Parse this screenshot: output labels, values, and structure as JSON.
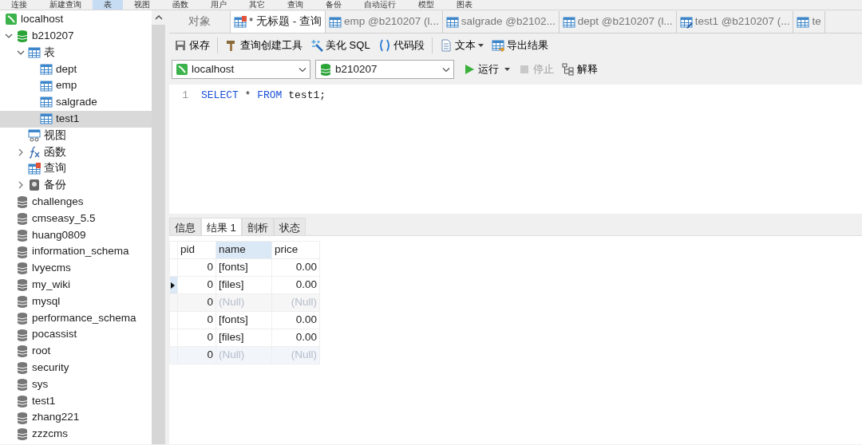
{
  "menu": [
    {
      "label": "连接",
      "selected": false
    },
    {
      "label": "新建查询",
      "selected": false
    },
    {
      "label": "表",
      "selected": true
    },
    {
      "label": "视图",
      "selected": false
    },
    {
      "label": "函数",
      "selected": false
    },
    {
      "label": "用户",
      "selected": false
    },
    {
      "label": "其它",
      "selected": false
    },
    {
      "label": "查询",
      "selected": false
    },
    {
      "label": "备份",
      "selected": false
    },
    {
      "label": "自动运行",
      "selected": false
    },
    {
      "label": "模型",
      "selected": false
    },
    {
      "label": "图表",
      "selected": false
    }
  ],
  "sidebar": {
    "items": [
      {
        "label": "localhost",
        "kind": "connection",
        "selected": false
      },
      {
        "label": "b210207",
        "kind": "database",
        "open": true,
        "expanded": true,
        "selected": false,
        "children": [
          {
            "label": "表",
            "kind": "tables",
            "expanded": true,
            "selected": false,
            "children": [
              {
                "label": "dept",
                "kind": "table",
                "selected": false
              },
              {
                "label": "emp",
                "kind": "table",
                "selected": false
              },
              {
                "label": "salgrade",
                "kind": "table",
                "selected": false
              },
              {
                "label": "test1",
                "kind": "table",
                "selected": true
              }
            ]
          },
          {
            "label": "视图",
            "kind": "views",
            "selected": false
          },
          {
            "label": "函数",
            "kind": "functions",
            "expanded": false,
            "selected": false
          },
          {
            "label": "查询",
            "kind": "queries",
            "selected": false
          },
          {
            "label": "备份",
            "kind": "backups",
            "expanded": false,
            "selected": false
          }
        ]
      },
      {
        "label": "challenges",
        "kind": "database",
        "open": false,
        "selected": false
      },
      {
        "label": "cmseasy_5.5",
        "kind": "database",
        "open": false,
        "selected": false
      },
      {
        "label": "huang0809",
        "kind": "database",
        "open": false,
        "selected": false
      },
      {
        "label": "information_schema",
        "kind": "database",
        "open": false,
        "selected": false
      },
      {
        "label": "lvyecms",
        "kind": "database",
        "open": false,
        "selected": false
      },
      {
        "label": "my_wiki",
        "kind": "database",
        "open": false,
        "selected": false
      },
      {
        "label": "mysql",
        "kind": "database",
        "open": false,
        "selected": false
      },
      {
        "label": "performance_schema",
        "kind": "database",
        "open": false,
        "selected": false
      },
      {
        "label": "pocassist",
        "kind": "database",
        "open": false,
        "selected": false
      },
      {
        "label": "root",
        "kind": "database",
        "open": false,
        "selected": false
      },
      {
        "label": "security",
        "kind": "database",
        "open": false,
        "selected": false
      },
      {
        "label": "sys",
        "kind": "database",
        "open": false,
        "selected": false
      },
      {
        "label": "test1",
        "kind": "database",
        "open": false,
        "selected": false
      },
      {
        "label": "zhang221",
        "kind": "database",
        "open": false,
        "selected": false
      },
      {
        "label": "zzzcms",
        "kind": "database",
        "open": false,
        "selected": false
      }
    ]
  },
  "tabs": [
    {
      "label": "对象",
      "kind": "plain",
      "selected": false
    },
    {
      "label": "* 无标题 - 查询",
      "kind": "query",
      "selected": true
    },
    {
      "label": "emp @b210207 (l...",
      "kind": "table",
      "selected": false
    },
    {
      "label": "salgrade @b2102...",
      "kind": "table",
      "selected": false
    },
    {
      "label": "dept @b210207 (l...",
      "kind": "table",
      "selected": false
    },
    {
      "label": "test1 @b210207 (...",
      "kind": "table-edit",
      "selected": false
    },
    {
      "label": "te",
      "kind": "table",
      "selected": false
    }
  ],
  "toolbar": [
    {
      "label": "保存",
      "kind": "save"
    },
    {
      "label": "查询创建工具",
      "kind": "builder"
    },
    {
      "label": "美化 SQL",
      "kind": "beautify"
    },
    {
      "label": "代码段",
      "kind": "snippet"
    },
    {
      "label": "文本",
      "kind": "text",
      "dropdown": true
    },
    {
      "label": "导出结果",
      "kind": "export"
    }
  ],
  "connection_select": {
    "value": "localhost"
  },
  "database_select": {
    "value": "b210207"
  },
  "actions": [
    {
      "label": "运行",
      "kind": "run",
      "dropdown": true,
      "disabled": false
    },
    {
      "label": "停止",
      "kind": "stop",
      "disabled": true
    },
    {
      "label": "解释",
      "kind": "explain",
      "disabled": false
    }
  ],
  "editor": {
    "lines": [
      {
        "number": "1",
        "tokens": [
          {
            "text": "SELECT",
            "kind": "keyword"
          },
          {
            "text": " * ",
            "kind": "plain"
          },
          {
            "text": "FROM",
            "kind": "keyword"
          },
          {
            "text": " test1;",
            "kind": "plain"
          }
        ]
      }
    ]
  },
  "result_tabs": [
    {
      "label": "信息",
      "selected": false
    },
    {
      "label": "结果 1",
      "selected": true
    },
    {
      "label": "剖析",
      "selected": false
    },
    {
      "label": "状态",
      "selected": false
    }
  ],
  "table": {
    "columns": [
      {
        "label": "pid",
        "selected": false
      },
      {
        "label": "name",
        "selected": true
      },
      {
        "label": "price",
        "selected": false
      }
    ],
    "rows": [
      {
        "current": false,
        "cells": [
          {
            "text": "0",
            "null": false
          },
          {
            "text": "[fonts]",
            "null": false
          },
          {
            "text": "0.00",
            "null": false
          }
        ]
      },
      {
        "current": true,
        "cells": [
          {
            "text": "0",
            "null": false
          },
          {
            "text": "[files]",
            "null": false
          },
          {
            "text": "0.00",
            "null": false
          }
        ]
      },
      {
        "current": false,
        "color": "#f6f6f6",
        "cells": [
          {
            "text": "0",
            "null": false
          },
          {
            "text": "(Null)",
            "null": true
          },
          {
            "text": "(Null)",
            "null": true
          }
        ]
      },
      {
        "current": false,
        "cells": [
          {
            "text": "0",
            "null": false
          },
          {
            "text": "[fonts]",
            "null": false
          },
          {
            "text": "0.00",
            "null": false
          }
        ]
      },
      {
        "current": false,
        "cells": [
          {
            "text": "0",
            "null": false
          },
          {
            "text": "[files]",
            "null": false
          },
          {
            "text": "0.00",
            "null": false
          }
        ]
      },
      {
        "current": false,
        "color": "#f2f6fb",
        "cells": [
          {
            "text": "0",
            "null": false
          },
          {
            "text": "(Null)",
            "null": true
          },
          {
            "text": "(Null)",
            "null": true
          }
        ]
      }
    ]
  }
}
